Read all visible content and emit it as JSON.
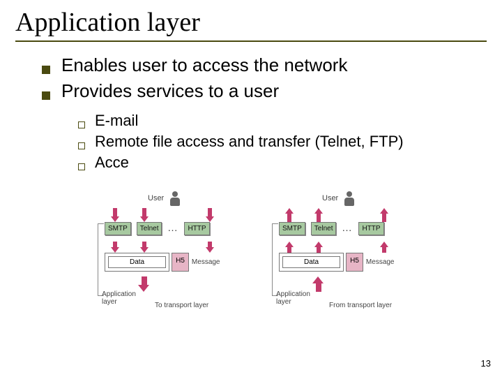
{
  "title": "Application layer",
  "bullets_l1": [
    "Enables user to access the network",
    "Provides services to a user"
  ],
  "bullets_l2": [
    "E-mail",
    "Remote file access and transfer (Telnet, FTP)",
    "Acce"
  ],
  "diagram": {
    "user_label": "User",
    "protocols": [
      "SMTP",
      "Telnet",
      "HTTP"
    ],
    "dots": "…",
    "data_label": "Data",
    "header_label": "H5",
    "message_label": "Message",
    "app_layer_label": "Application\nlayer",
    "left_caption": "To transport layer",
    "right_caption": "From transport layer"
  },
  "page_number": "13"
}
